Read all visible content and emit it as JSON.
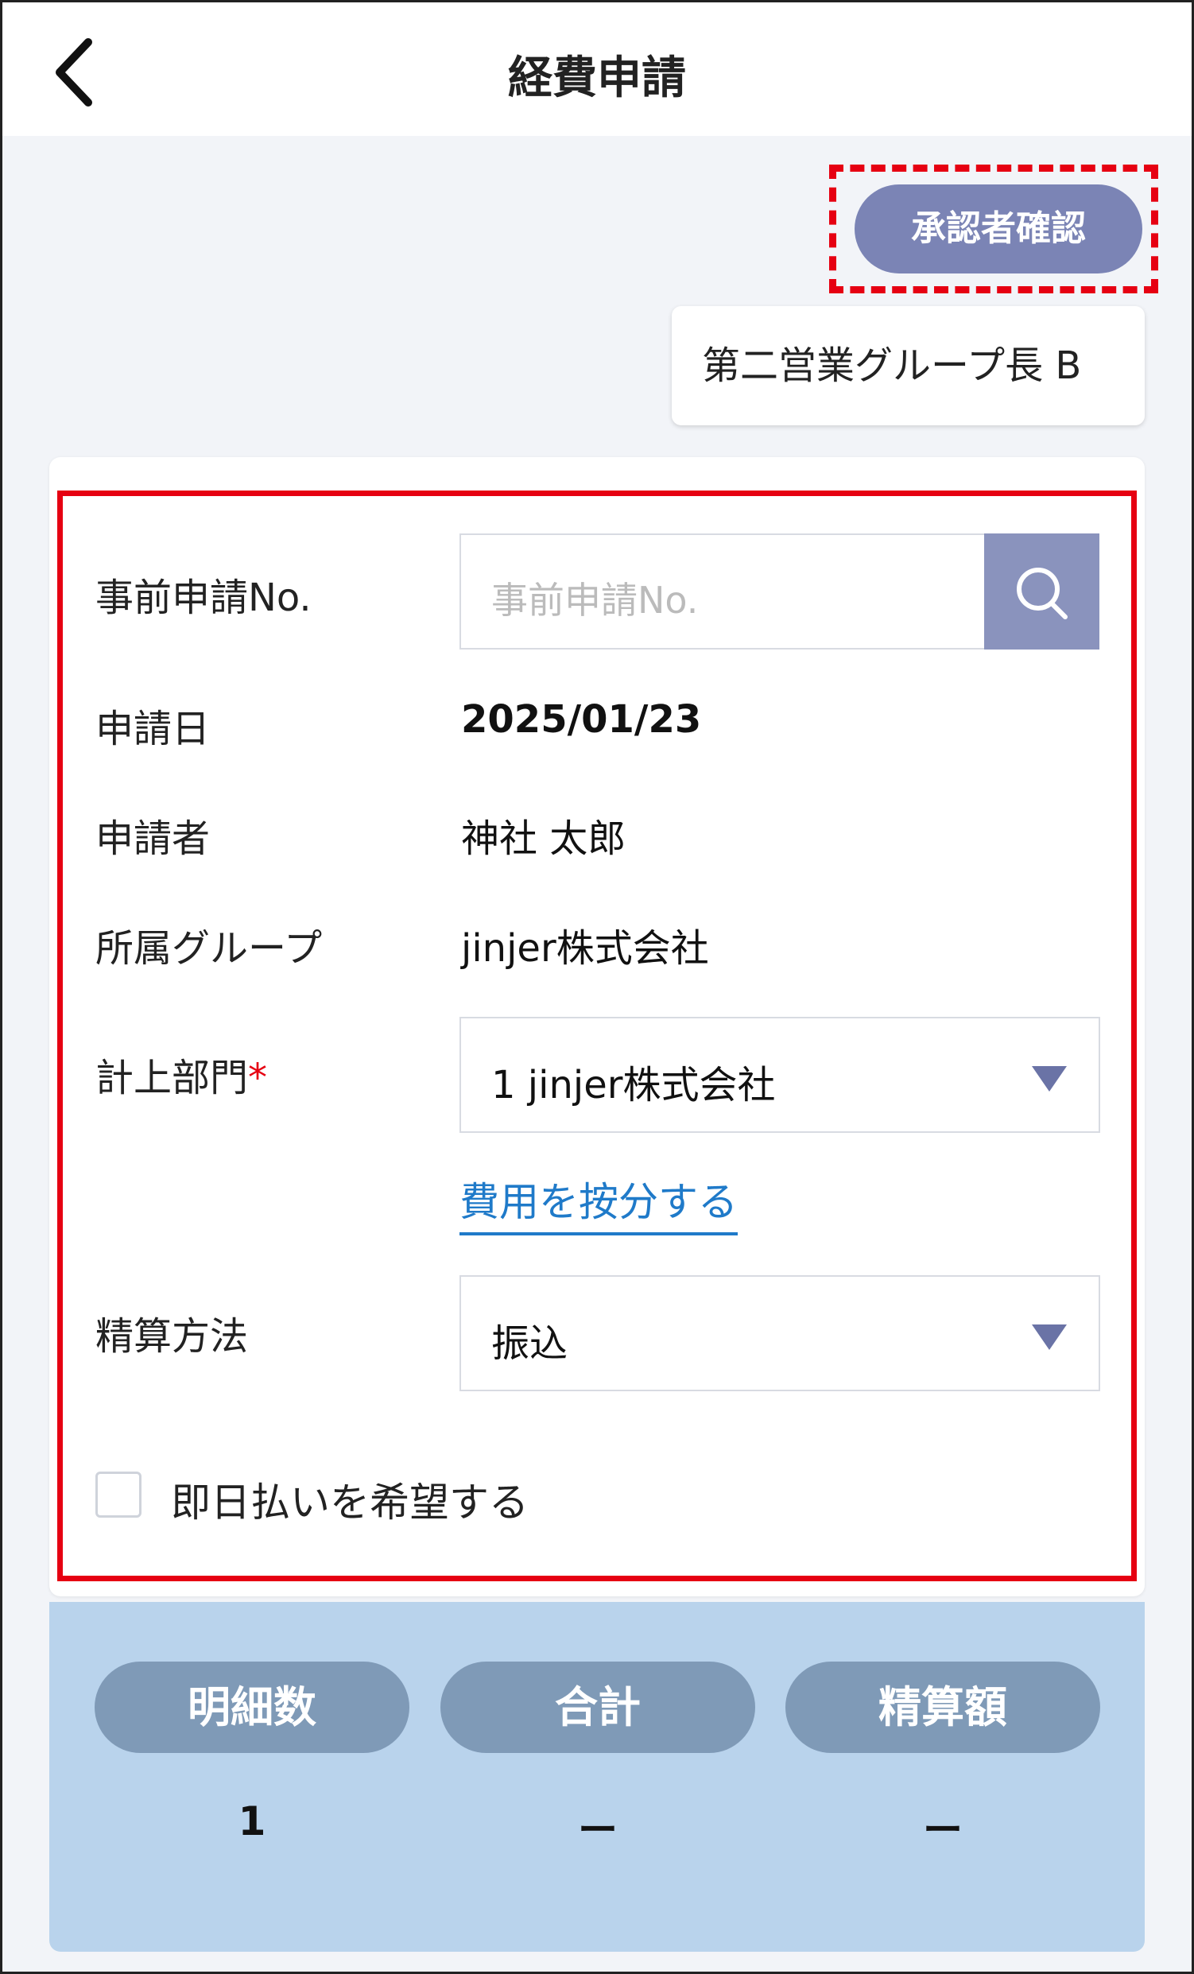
{
  "header": {
    "title": "経費申請",
    "back_icon": "chevron-left-icon"
  },
  "approver": {
    "button_label": "承認者確認",
    "name": "第二営業グループ長 B"
  },
  "form": {
    "pre_app_no": {
      "label": "事前申請No.",
      "placeholder": "事前申請No.",
      "search_icon": "search-icon"
    },
    "app_date": {
      "label": "申請日",
      "value": "2025/01/23"
    },
    "applicant": {
      "label": "申請者",
      "value": "神社 太郎"
    },
    "group": {
      "label": "所属グループ",
      "value": "jinjer株式会社"
    },
    "dept": {
      "label": "計上部門",
      "required_mark": "*",
      "value": "1 jinjer株式会社"
    },
    "allocate_link": "費用を按分する",
    "settlement": {
      "label": "精算方法",
      "value": "振込"
    },
    "same_day": {
      "label": "即日払いを希望する",
      "checked": false
    }
  },
  "summary": {
    "items": [
      {
        "label": "明細数",
        "value": "1"
      },
      {
        "label": "合計",
        "value": "ー"
      },
      {
        "label": "精算額",
        "value": "ー"
      }
    ]
  },
  "colors": {
    "highlight_red": "#e60012",
    "accent": "#7b84b5",
    "link": "#1f7ac9",
    "summary_bg": "#b9d3ec"
  }
}
